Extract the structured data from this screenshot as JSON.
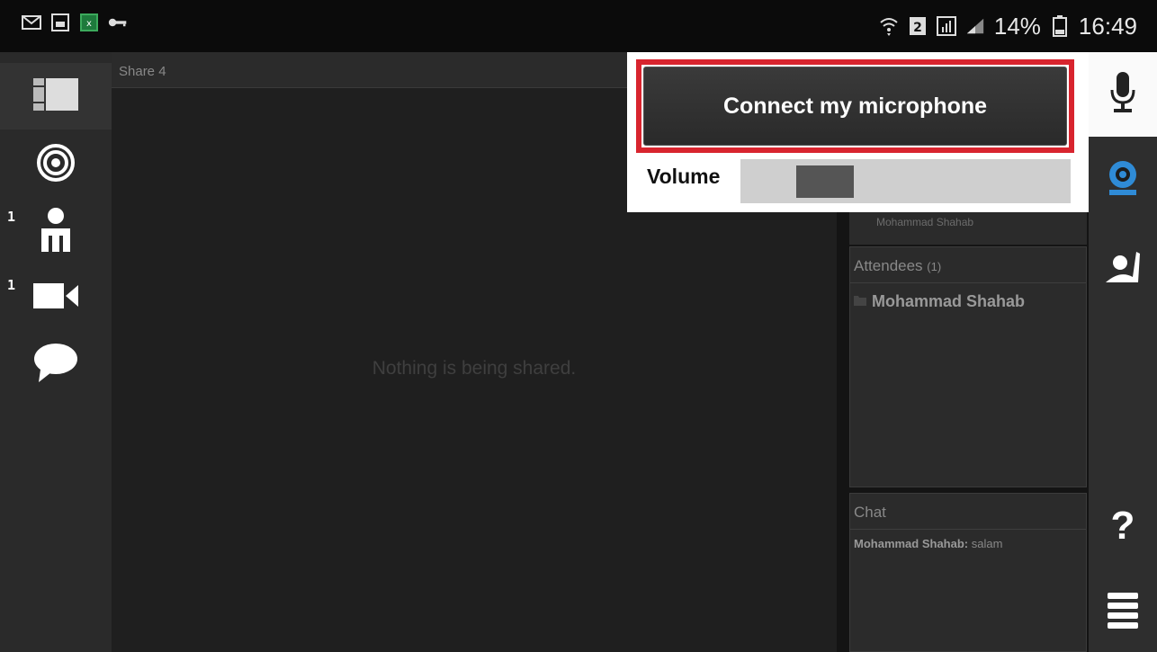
{
  "status_bar": {
    "left_icons": [
      "mail-icon",
      "image-icon",
      "spreadsheet-icon",
      "key-icon"
    ],
    "right_icons": [
      "wifi-icon",
      "sim-icon",
      "data-icon",
      "signal-icon",
      "battery-icon"
    ],
    "battery": "14%",
    "time": "16:49"
  },
  "left_sidebar": {
    "items": [
      {
        "name": "layout-icon",
        "badge": ""
      },
      {
        "name": "broadcast-icon",
        "badge": ""
      },
      {
        "name": "attendees-icon",
        "badge": "1"
      },
      {
        "name": "camera-icon",
        "badge": "1"
      },
      {
        "name": "chat-icon",
        "badge": ""
      }
    ]
  },
  "share": {
    "title": "Share 4",
    "empty_message": "Nothing is being shared."
  },
  "camera_pod": {
    "name": "Mohammad Shahab"
  },
  "attendees": {
    "title": "Attendees",
    "count": "(1)",
    "list": [
      "Mohammad Shahab"
    ]
  },
  "chat": {
    "title": "Chat",
    "messages": [
      {
        "sender": "Mohammad Shahab:",
        "text": "salam"
      }
    ]
  },
  "popover": {
    "connect_label": "Connect my microphone",
    "volume_label": "Volume",
    "volume_level": 0.17,
    "highlight_color": "#d8242e"
  },
  "right_toolbar": {
    "items": [
      "microphone-icon",
      "webcam-icon",
      "raise-hand-icon",
      "help-icon",
      "menu-icon"
    ],
    "help_label": "?"
  },
  "colors": {
    "accent": "#2f8bd6"
  }
}
